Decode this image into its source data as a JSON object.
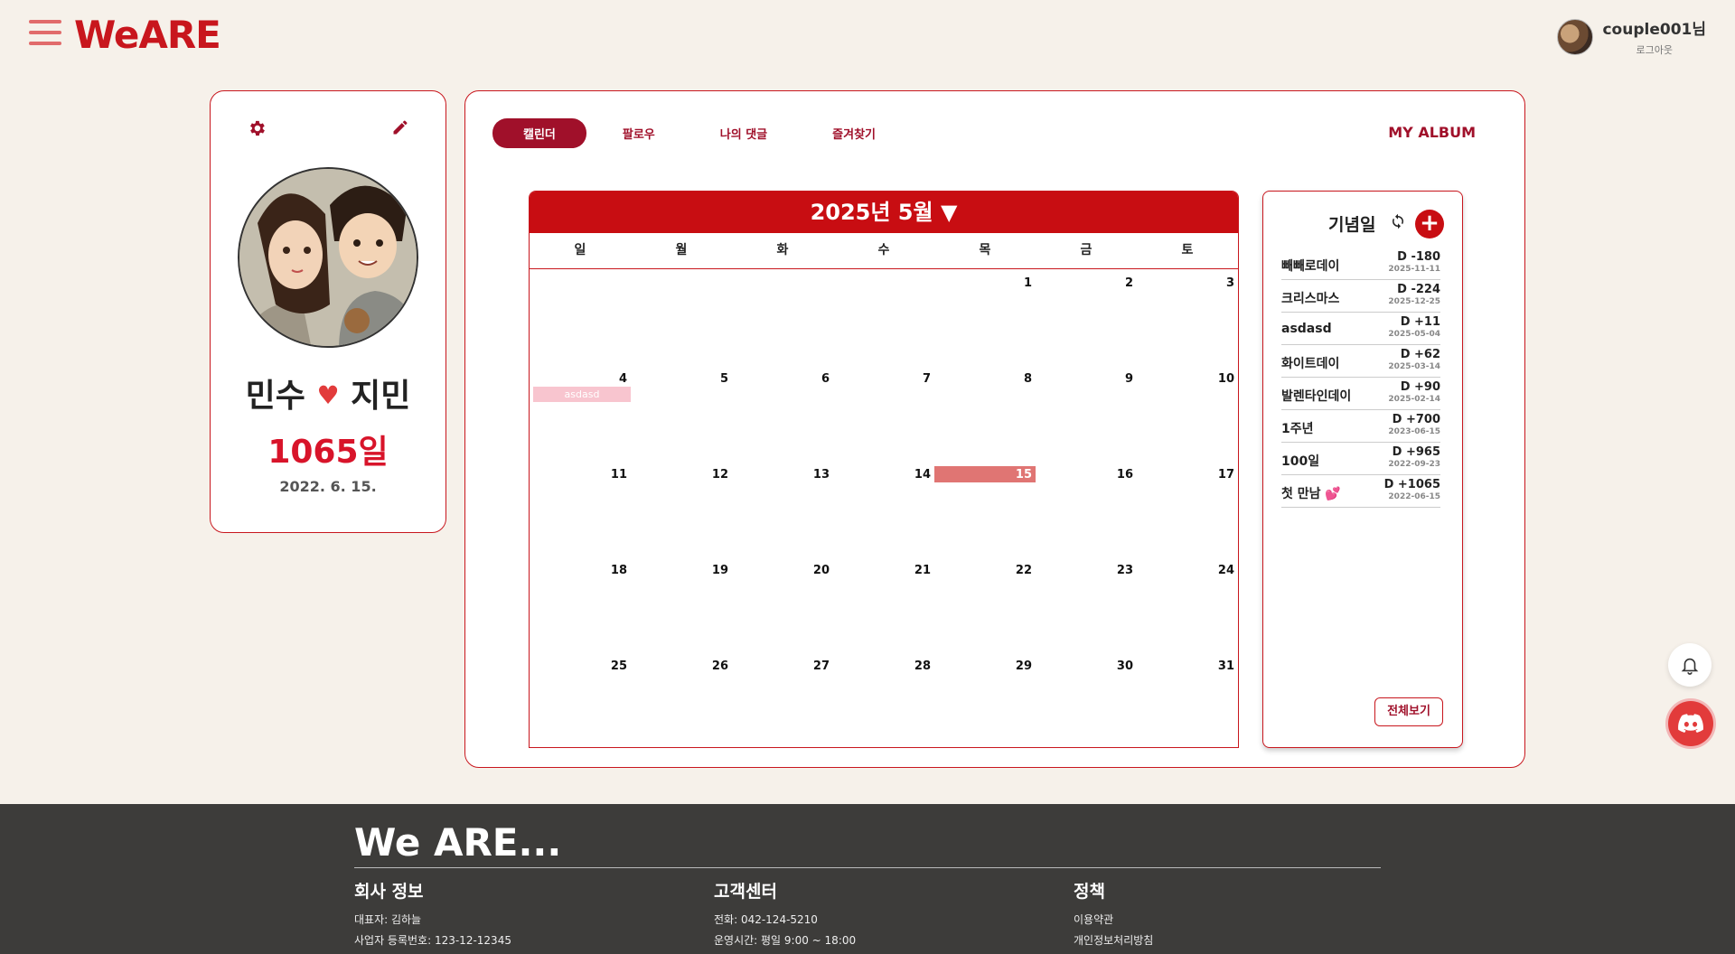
{
  "header": {
    "logo": "WeARE",
    "username": "couple001님",
    "logout": "로그아웃"
  },
  "profile": {
    "name1": "민수",
    "heart": "♥",
    "name2": "지민",
    "days": "1065일",
    "start_date": "2022. 6. 15."
  },
  "tabs": [
    {
      "label": "캘린더",
      "active": true
    },
    {
      "label": "팔로우",
      "active": false
    },
    {
      "label": "나의 댓글",
      "active": false
    },
    {
      "label": "즐겨찾기",
      "active": false
    }
  ],
  "my_album": "MY ALBUM",
  "calendar": {
    "title": "2025년 5월 ▼",
    "weekdays": [
      "일",
      "월",
      "화",
      "수",
      "목",
      "금",
      "토"
    ],
    "cells": [
      "",
      "",
      "",
      "",
      "1",
      "2",
      "3",
      "4",
      "5",
      "6",
      "7",
      "8",
      "9",
      "10",
      "11",
      "12",
      "13",
      "14",
      "15",
      "16",
      "17",
      "18",
      "19",
      "20",
      "21",
      "22",
      "23",
      "24",
      "25",
      "26",
      "27",
      "28",
      "29",
      "30",
      "31"
    ],
    "today": "15",
    "events": [
      {
        "day": "4",
        "label": "asdasd",
        "color": "#f8c5cf"
      }
    ]
  },
  "anniversaries": {
    "title": "기념일",
    "items": [
      {
        "name": "빼빼로데이",
        "dday": "D -180",
        "date": "2025-11-11"
      },
      {
        "name": "크리스마스",
        "dday": "D -224",
        "date": "2025-12-25"
      },
      {
        "name": "asdasd",
        "dday": "D +11",
        "date": "2025-05-04"
      },
      {
        "name": "화이트데이",
        "dday": "D +62",
        "date": "2025-03-14"
      },
      {
        "name": "발렌타인데이",
        "dday": "D +90",
        "date": "2025-02-14"
      },
      {
        "name": "1주년",
        "dday": "D +700",
        "date": "2023-06-15"
      },
      {
        "name": "100일",
        "dday": "D +965",
        "date": "2022-09-23"
      },
      {
        "name": "첫 만남 💕",
        "dday": "D +1065",
        "date": "2022-06-15"
      }
    ],
    "view_all": "전체보기"
  },
  "footer": {
    "title": "We ARE...",
    "company": {
      "heading": "회사 정보",
      "ceo": "대표자: 김하늘",
      "biz_no": "사업자 등록번호: 123-12-12345"
    },
    "support": {
      "heading": "고객센터",
      "phone": "전화: 042-124-5210",
      "hours": "운영시간: 평일 9:00 ~ 18:00"
    },
    "policy": {
      "heading": "정책",
      "terms": "이용약관",
      "privacy": "개인정보처리방침"
    }
  },
  "colors": {
    "brand": "#c8161d",
    "accent": "#a0102a",
    "today": "#e07573",
    "footer_bg": "#3d3c3a"
  }
}
